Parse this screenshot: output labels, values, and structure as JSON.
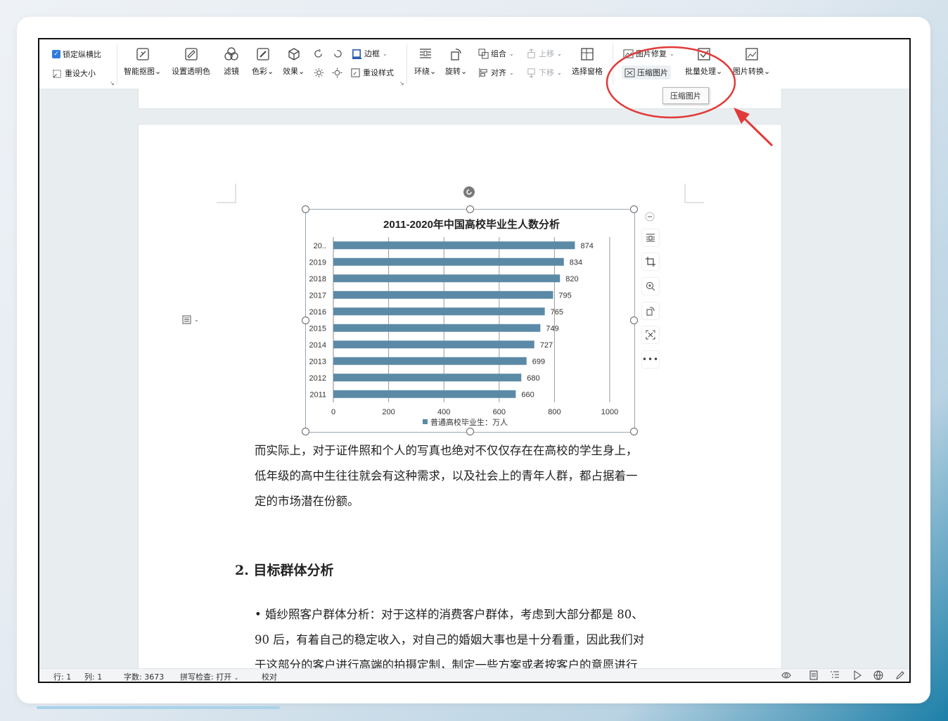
{
  "toolbar": {
    "lock_ratio": "锁定纵横比",
    "reset_size": "重设大小",
    "smart_cutout": "智能抠图",
    "set_transparent": "设置透明色",
    "filter": "滤镜",
    "color": "色彩",
    "effects": "效果",
    "border": "边框",
    "reset_style": "重设样式",
    "wrap": "环绕",
    "rotate": "旋转",
    "group": "组合",
    "align": "对齐",
    "move_up": "上移",
    "move_down": "下移",
    "selection_pane": "选择窗格",
    "image_repair": "图片修复",
    "compress_image": "压缩图片",
    "batch_process": "批量处理",
    "image_convert": "图片转换",
    "tooltip": "压缩图片"
  },
  "document": {
    "paragraph1_lines": [
      "而实际上，对于证件照和个人的写真也绝对不仅仅存在在高校的学生身上，",
      "低年级的高中生往往就会有这种需求，以及社会上的青年人群，都占据着一",
      "定的市场潜在份额。"
    ],
    "heading": "2. 目标群体分析",
    "paragraph2_lines": [
      "• 婚纱照客户群体分析：对于这样的消费客户群体，考虑到大部分都是 80、",
      "90 后，有着自己的稳定收入，对自己的婚姻大事也是十分看重，因此我们对",
      "于这部分的客户进行高端的拍摄定制，制定一些方案或者按客户的意愿进行"
    ]
  },
  "status": {
    "row": "行: 1",
    "col": "列: 1",
    "word_count": "字数: 3673",
    "spell_check": "拼写检查: 打开",
    "proofread": "校对"
  },
  "colors": {
    "bar": "#5b8aa6",
    "annotation": "#e23a3a",
    "accent": "#2f7bdc"
  },
  "chart_data": {
    "type": "bar",
    "orientation": "horizontal",
    "title": "2011-2020年中国高校毕业生人数分析",
    "categories": [
      "20..",
      "2019",
      "2018",
      "2017",
      "2016",
      "2015",
      "2014",
      "2013",
      "2012",
      "2011"
    ],
    "series": [
      {
        "name": "普通高校毕业生：万人",
        "values": [
          874,
          834,
          820,
          795,
          765,
          749,
          727,
          699,
          680,
          660
        ]
      }
    ],
    "xlim": [
      0,
      1000
    ],
    "xticks": [
      0,
      200,
      400,
      600,
      800,
      1000
    ],
    "grid": true,
    "legend": "bottom"
  }
}
